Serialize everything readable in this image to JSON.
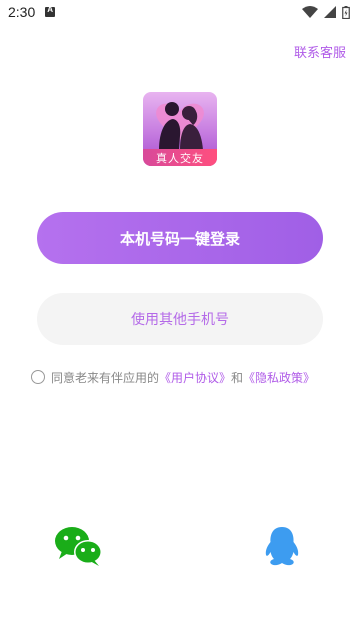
{
  "status_bar": {
    "time": "2:30",
    "icons": [
      "notification-a-icon",
      "wifi-icon",
      "cell-signal-icon",
      "battery-icon"
    ]
  },
  "header": {
    "support_label": "联系客服"
  },
  "logo": {
    "caption": "真人交友",
    "icon": "couple-silhouette-icon"
  },
  "buttons": {
    "one_click_login": "本机号码一键登录",
    "other_phone": "使用其他手机号"
  },
  "agreement": {
    "prefix": "同意老来有伴应用的",
    "user_agreement": "《用户协议》",
    "conjunction": "和",
    "privacy_policy": "《隐私政策》",
    "checked": false
  },
  "social_login": {
    "icons": [
      "wechat-icon",
      "qq-icon"
    ]
  },
  "colors": {
    "accent": "#b05ce8",
    "primary_button": "#a66ae9",
    "secondary_button_bg": "#f4f4f4",
    "wechat": "#1aad19",
    "qq": "#3d9cf0"
  }
}
